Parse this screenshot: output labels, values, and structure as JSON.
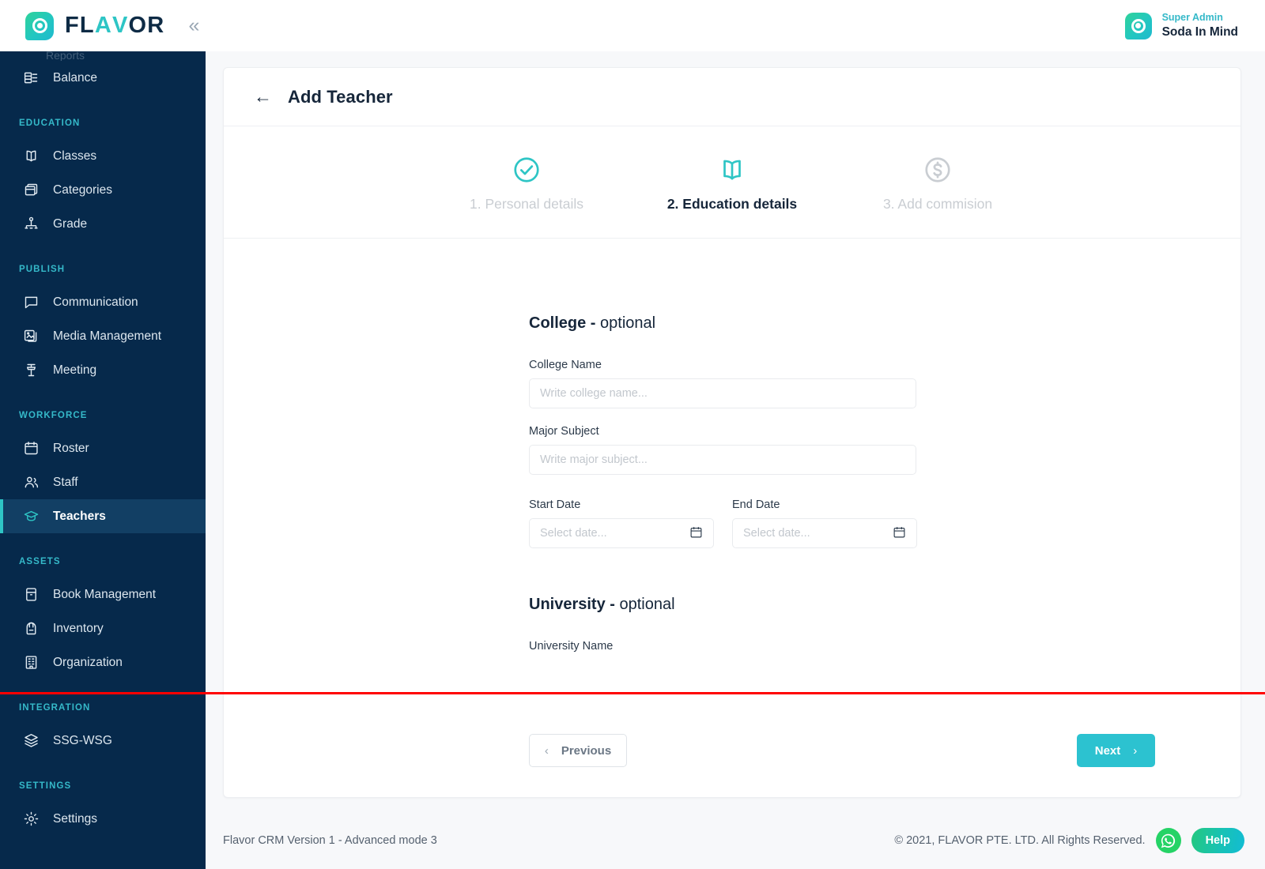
{
  "brand": {
    "name_part1": "FL",
    "name_part2": "A",
    "name_part3": "V",
    "name_part4": "OR",
    "logo_icon": "flavor-target-logo",
    "collapse_icon": "double-chevron-left-icon"
  },
  "user": {
    "role": "Super Admin",
    "name": "Soda In Mind",
    "avatar_icon": "flavor-target-logo"
  },
  "sidebar": {
    "groups": [
      {
        "section": "",
        "items": [
          {
            "label": "Balance",
            "icon": "balance-stack-icon",
            "active": false
          }
        ]
      },
      {
        "section": "EDUCATION",
        "items": [
          {
            "label": "Classes",
            "icon": "open-book-icon",
            "active": false
          },
          {
            "label": "Categories",
            "icon": "box-icon",
            "active": false
          },
          {
            "label": "Grade",
            "icon": "hierarchy-icon",
            "active": false
          }
        ]
      },
      {
        "section": "PUBLISH",
        "items": [
          {
            "label": "Communication",
            "icon": "chat-bubble-icon",
            "active": false
          },
          {
            "label": "Media Management",
            "icon": "image-stack-icon",
            "active": false
          },
          {
            "label": "Meeting",
            "icon": "podium-icon",
            "active": false
          }
        ]
      },
      {
        "section": "WORKFORCE",
        "items": [
          {
            "label": "Roster",
            "icon": "calendar-icon",
            "active": false
          },
          {
            "label": "Staff",
            "icon": "people-icon",
            "active": false
          },
          {
            "label": "Teachers",
            "icon": "graduation-cap-icon",
            "active": true
          }
        ]
      },
      {
        "section": "ASSETS",
        "items": [
          {
            "label": "Book Management",
            "icon": "book-icon",
            "active": false
          },
          {
            "label": "Inventory",
            "icon": "backpack-icon",
            "active": false
          },
          {
            "label": "Organization",
            "icon": "building-icon",
            "active": false
          }
        ]
      },
      {
        "section": "INTEGRATION",
        "items": [
          {
            "label": "SSG-WSG",
            "icon": "layers-icon",
            "active": false
          }
        ]
      },
      {
        "section": "SETTINGS",
        "items": [
          {
            "label": "Settings",
            "icon": "gear-icon",
            "active": false
          }
        ]
      }
    ]
  },
  "page": {
    "title": "Add Teacher",
    "back_icon": "arrow-left-icon"
  },
  "stepper": {
    "steps": [
      {
        "label": "1. Personal details",
        "state": "done",
        "icon": "check-circle-icon"
      },
      {
        "label": "2. Education details",
        "state": "active",
        "icon": "open-book-icon"
      },
      {
        "label": "3. Add commision",
        "state": "todo",
        "icon": "dollar-circle-icon"
      }
    ]
  },
  "form": {
    "college": {
      "heading_bold": "College -",
      "heading_rest": " optional",
      "college_name": {
        "label": "College Name",
        "placeholder": "Write college name...",
        "value": ""
      },
      "major_subject": {
        "label": "Major Subject",
        "placeholder": "Write major subject...",
        "value": ""
      },
      "start_date": {
        "label": "Start Date",
        "placeholder": "Select date...",
        "value": "",
        "icon": "calendar-icon"
      },
      "end_date": {
        "label": "End Date",
        "placeholder": "Select date...",
        "value": "",
        "icon": "calendar-icon"
      }
    },
    "university": {
      "heading_bold": "University -",
      "heading_rest": " optional",
      "university_name": {
        "label": "University Name"
      }
    }
  },
  "actions": {
    "previous_label": "Previous",
    "previous_icon": "chevron-left-icon",
    "next_label": "Next",
    "next_icon": "chevron-right-icon",
    "next_color": "#2cc2d0"
  },
  "footer": {
    "version": "Flavor CRM Version 1 - Advanced mode 3",
    "copyright": "© 2021, FLAVOR PTE. LTD. All Rights Reserved.",
    "whatsapp_icon": "whatsapp-icon",
    "help_label": "Help"
  },
  "colors": {
    "accent": "#2ec5c5",
    "sidebar_bg": "#06294b",
    "sidebar_active_bg": "#123f64",
    "navy_text": "#16263a",
    "red_divider": "#ff0000"
  }
}
